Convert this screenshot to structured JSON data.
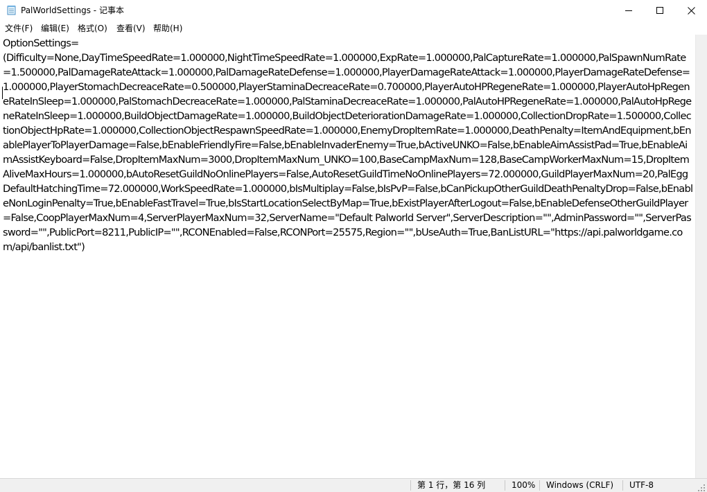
{
  "window": {
    "title": "PalWorldSettings - 记事本"
  },
  "menu": {
    "items": [
      {
        "label": "文件(F)"
      },
      {
        "label": "编辑(E)"
      },
      {
        "label": "格式(O)"
      },
      {
        "label": "查看(V)"
      },
      {
        "label": "帮助(H)"
      }
    ]
  },
  "editor": {
    "content": "OptionSettings=\n(Difficulty=None,DayTimeSpeedRate=1.000000,NightTimeSpeedRate=1.000000,ExpRate=1.000000,PalCaptureRate=1.000000,PalSpawnNumRate=1.500000,PalDamageRateAttack=1.000000,PalDamageRateDefense=1.000000,PlayerDamageRateAttack=1.000000,PlayerDamageRateDefense=1.000000,PlayerStomachDecreaceRate=0.500000,PlayerStaminaDecreaceRate=0.700000,PlayerAutoHPRegeneRate=1.000000,PlayerAutoHpRegeneRateInSleep=1.000000,PalStomachDecreaceRate=1.000000,PalStaminaDecreaceRate=1.000000,PalAutoHPRegeneRate=1.000000,PalAutoHpRegeneRateInSleep=1.000000,BuildObjectDamageRate=1.000000,BuildObjectDeteriorationDamageRate=1.000000,CollectionDropRate=1.500000,CollectionObjectHpRate=1.000000,CollectionObjectRespawnSpeedRate=1.000000,EnemyDropItemRate=1.000000,DeathPenalty=ItemAndEquipment,bEnablePlayerToPlayerDamage=False,bEnableFriendlyFire=False,bEnableInvaderEnemy=True,bActiveUNKO=False,bEnableAimAssistPad=True,bEnableAimAssistKeyboard=False,DropItemMaxNum=3000,DropItemMaxNum_UNKO=100,BaseCampMaxNum=128,BaseCampWorkerMaxNum=15,DropItemAliveMaxHours=1.000000,bAutoResetGuildNoOnlinePlayers=False,AutoResetGuildTimeNoOnlinePlayers=72.000000,GuildPlayerMaxNum=20,PalEggDefaultHatchingTime=72.000000,WorkSpeedRate=1.000000,bIsMultiplay=False,bIsPvP=False,bCanPickupOtherGuildDeathPenaltyDrop=False,bEnableNonLoginPenalty=True,bEnableFastTravel=True,bIsStartLocationSelectByMap=True,bExistPlayerAfterLogout=False,bEnableDefenseOtherGuildPlayer=False,CoopPlayerMaxNum=4,ServerPlayerMaxNum=32,ServerName=\"Default Palworld Server\",ServerDescription=\"\",AdminPassword=\"\",ServerPassword=\"\",PublicPort=8211,PublicIP=\"\",RCONEnabled=False,RCONPort=25575,Region=\"\",bUseAuth=True,BanListURL=\"https://api.palworldgame.com/api/banlist.txt\")"
  },
  "statusbar": {
    "position": "第 1 行，第 16 列",
    "zoom": "100%",
    "line_ending": "Windows (CRLF)",
    "encoding": "UTF-8"
  },
  "icons": {
    "app": "notepad-icon",
    "minimize": "minimize-icon",
    "maximize": "maximize-icon",
    "close": "close-icon",
    "grip": "resize-grip-icon"
  }
}
